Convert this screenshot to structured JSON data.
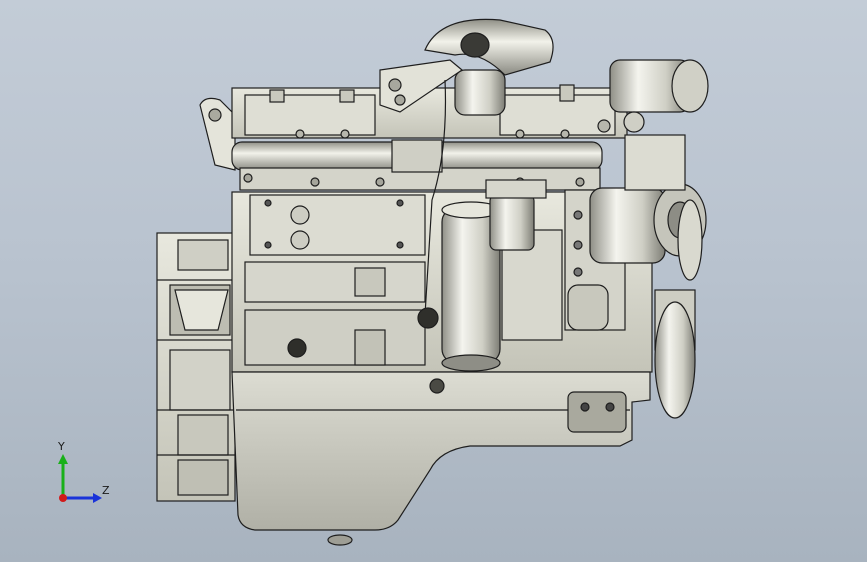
{
  "viewport": {
    "background_top": "#c3ccd7",
    "background_bottom": "#a8b3bf"
  },
  "model": {
    "subject": "engine-assembly",
    "colors": {
      "body": "#d8d8cc",
      "shade": "#9c9c92",
      "outline": "#1e1e1e",
      "highlight": "#f2f2ea"
    }
  },
  "triad": {
    "y_label": "Y",
    "z_label": "Z",
    "colors": {
      "y": "#19b019",
      "z": "#1a33d9",
      "x": "#d11a1a"
    }
  }
}
